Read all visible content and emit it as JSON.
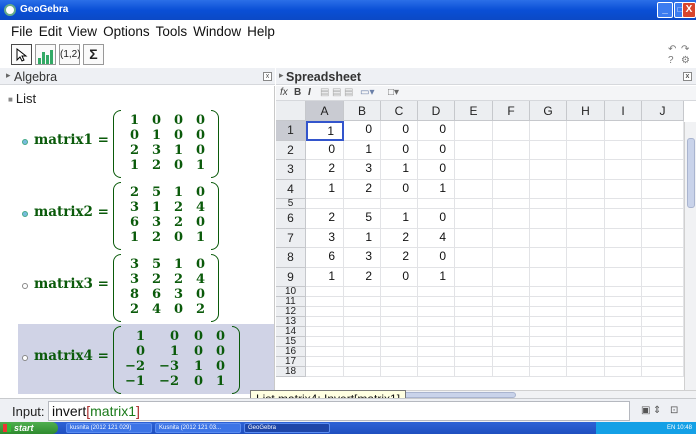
{
  "window": {
    "title": "GeoGebra",
    "controls": [
      "_",
      "□",
      "X"
    ]
  },
  "menu": [
    "File",
    "Edit",
    "View",
    "Options",
    "Tools",
    "Window",
    "Help"
  ],
  "toolbar": {
    "tools": [
      "move-tool",
      "bar-chart-tool",
      "(1,2)",
      "Σ"
    ]
  },
  "algebra": {
    "header": "Algebra",
    "list_label": "List",
    "matrices": [
      {
        "name": "matrix1 =",
        "rows": [
          [
            "1",
            "0",
            "0",
            "0"
          ],
          [
            "0",
            "1",
            "0",
            "0"
          ],
          [
            "2",
            "3",
            "1",
            "0"
          ],
          [
            "1",
            "2",
            "0",
            "1"
          ]
        ]
      },
      {
        "name": "matrix2 =",
        "rows": [
          [
            "2",
            "5",
            "1",
            "0"
          ],
          [
            "3",
            "1",
            "2",
            "4"
          ],
          [
            "6",
            "3",
            "2",
            "0"
          ],
          [
            "1",
            "2",
            "0",
            "1"
          ]
        ]
      },
      {
        "name": "matrix3 =",
        "rows": [
          [
            "3",
            "5",
            "1",
            "0"
          ],
          [
            "3",
            "2",
            "2",
            "4"
          ],
          [
            "8",
            "6",
            "3",
            "0"
          ],
          [
            "2",
            "4",
            "0",
            "2"
          ]
        ]
      },
      {
        "name": "matrix4 =",
        "rows": [
          [
            "1",
            "0",
            "0",
            "0"
          ],
          [
            "0",
            "1",
            "0",
            "0"
          ],
          [
            "−2",
            "−3",
            "1",
            "0"
          ],
          [
            "−1",
            "−2",
            "0",
            "1"
          ]
        ]
      }
    ]
  },
  "spreadsheet": {
    "header": "Spreadsheet",
    "tools": [
      "fx",
      "B",
      "I"
    ],
    "columns": [
      "A",
      "B",
      "C",
      "D",
      "E",
      "F",
      "G",
      "H",
      "I",
      "J"
    ],
    "rows": [
      {
        "n": "1",
        "cells": [
          "1",
          "0",
          "0",
          "0"
        ]
      },
      {
        "n": "2",
        "cells": [
          "0",
          "1",
          "0",
          "0"
        ]
      },
      {
        "n": "3",
        "cells": [
          "2",
          "3",
          "1",
          "0"
        ]
      },
      {
        "n": "4",
        "cells": [
          "1",
          "2",
          "0",
          "1"
        ]
      },
      {
        "n": "5",
        "cells": [
          "",
          "",
          "",
          ""
        ]
      },
      {
        "n": "6",
        "cells": [
          "2",
          "5",
          "1",
          "0"
        ]
      },
      {
        "n": "7",
        "cells": [
          "3",
          "1",
          "2",
          "4"
        ]
      },
      {
        "n": "8",
        "cells": [
          "6",
          "3",
          "2",
          "0"
        ]
      },
      {
        "n": "9",
        "cells": [
          "1",
          "2",
          "0",
          "1"
        ]
      },
      {
        "n": "10",
        "cells": []
      },
      {
        "n": "11",
        "cells": []
      },
      {
        "n": "12",
        "cells": []
      },
      {
        "n": "13",
        "cells": []
      },
      {
        "n": "14",
        "cells": []
      },
      {
        "n": "15",
        "cells": []
      },
      {
        "n": "16",
        "cells": []
      },
      {
        "n": "17",
        "cells": []
      },
      {
        "n": "18",
        "cells": []
      }
    ]
  },
  "tooltip": "List matrix4: Invert[matrix1]",
  "input": {
    "label": "Input:",
    "cmd": "invert",
    "open": "[",
    "arg": "matrix1",
    "close": "]"
  },
  "taskbar": {
    "start": "start",
    "tasks": [
      "kusnita (2012 121 029)",
      "Kusnita (2012 121 03...",
      "GeoGebra"
    ],
    "tray": "EN 10:48"
  }
}
